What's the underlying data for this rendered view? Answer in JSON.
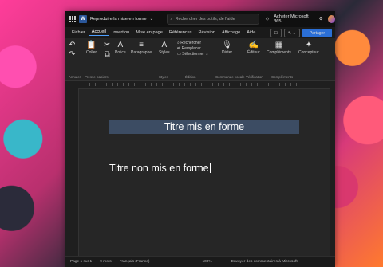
{
  "titlebar": {
    "doc_title": "Reproduire la mise en forme",
    "search_placeholder": "Rechercher des outils, de l'aide",
    "buy": "Acheter Microsoft 365"
  },
  "menu": {
    "tabs": [
      "Fichier",
      "Accueil",
      "Insertion",
      "Mise en page",
      "Références",
      "Révision",
      "Affichage",
      "Aide"
    ],
    "share": "Partager"
  },
  "ribbon": {
    "paste": "Coller",
    "font": "Police",
    "paragraph": "Paragraphe",
    "styles": "Styles",
    "find": "Rechercher",
    "replace": "Remplacer",
    "select": "Sélectionner",
    "dictate": "Dicter",
    "editor": "Éditeur",
    "addins": "Compléments",
    "designer": "Concepteur",
    "groups": {
      "undo": "Annuler",
      "clipboard": "Presse-papiers",
      "styles": "Styles",
      "editing": "Édition",
      "voice": "Commande vocale",
      "verify": "Vérification",
      "addins": "Compléments"
    }
  },
  "document": {
    "heading": "Titre mis en forme",
    "body": "Titre non mis en forme"
  },
  "status": {
    "page": "Page 1 sur 1",
    "words": "9 mots",
    "lang": "Français (France)",
    "zoom": "100%",
    "feedback": "Envoyer des commentaires à Microsoft"
  }
}
